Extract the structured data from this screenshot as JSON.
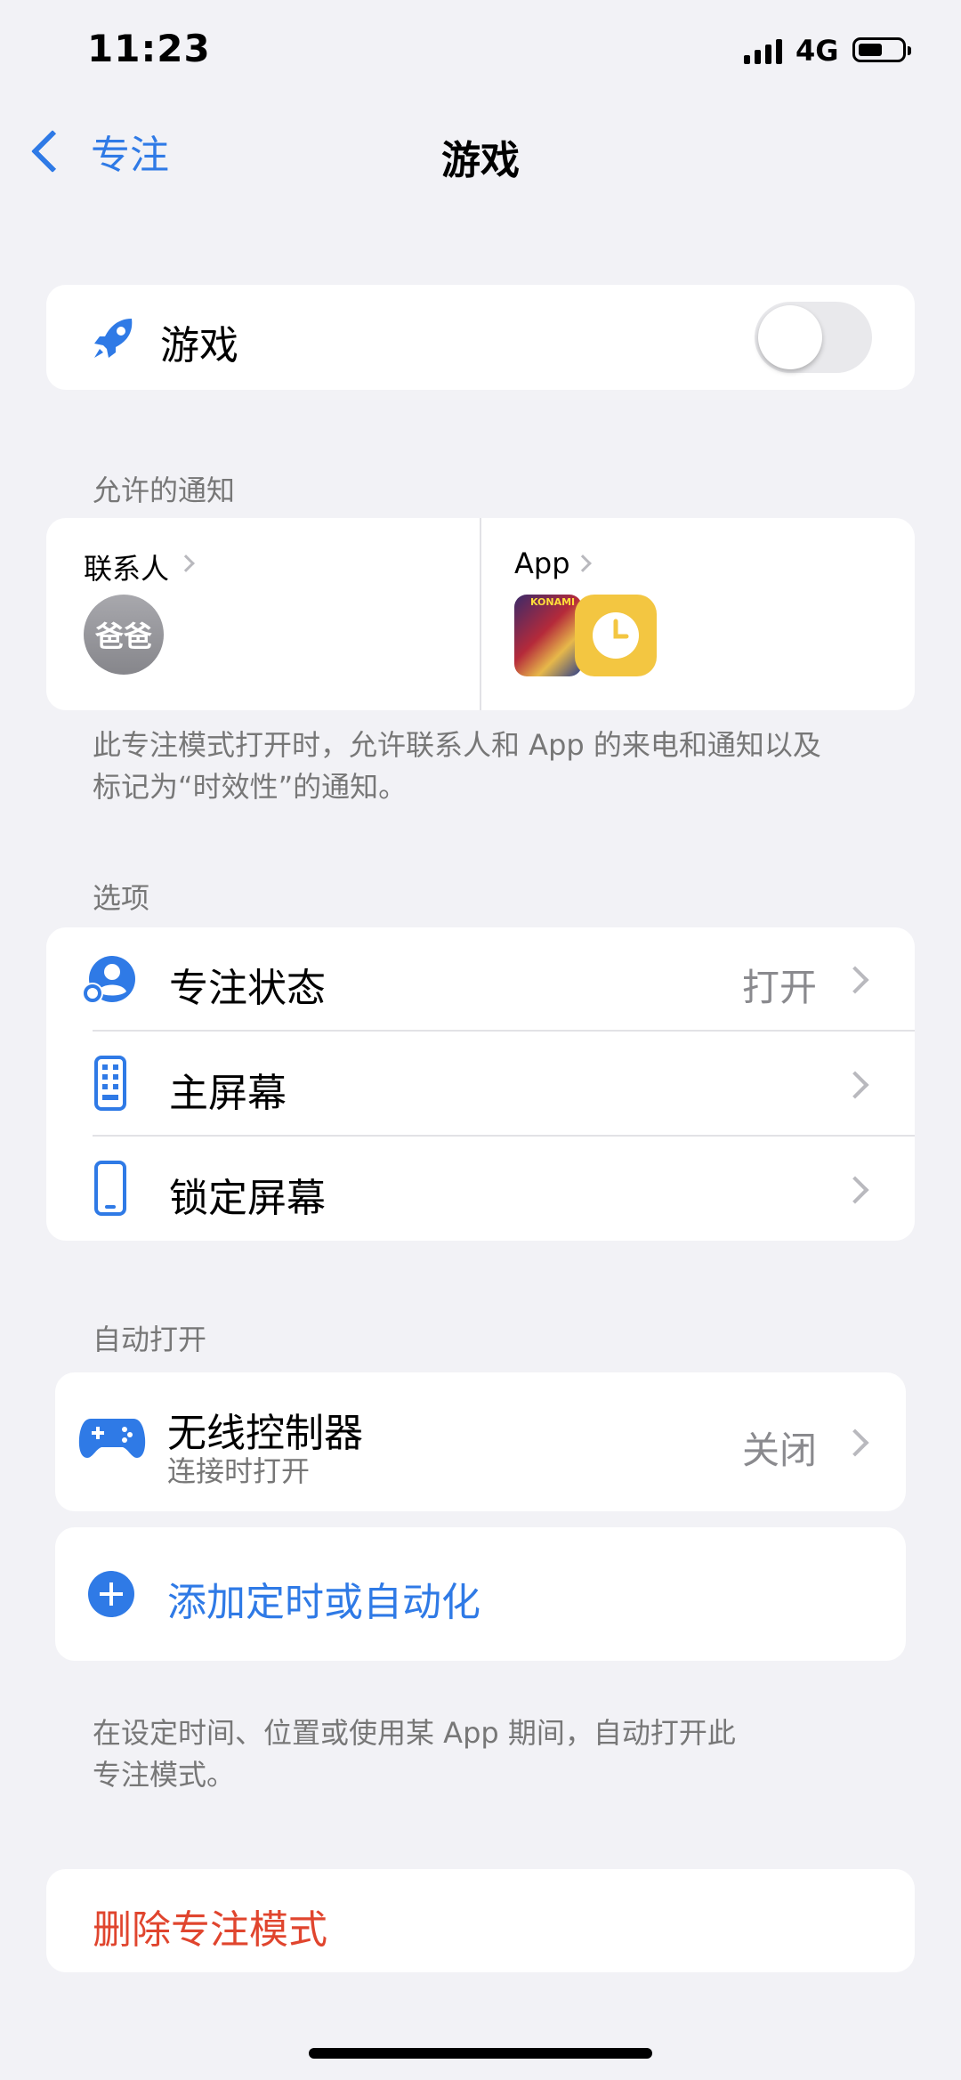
{
  "status_bar": {
    "time": "11:23",
    "network": "4G"
  },
  "nav": {
    "back_label": "专注",
    "title": "游戏"
  },
  "focus_toggle": {
    "label": "游戏",
    "enabled": false,
    "icon": "rocket-icon"
  },
  "allowed_notifications": {
    "section_label": "允许的通知",
    "people": {
      "label": "联系人",
      "contacts": [
        "爸爸"
      ]
    },
    "apps": {
      "label": "App",
      "icons": [
        "yugioh-app-icon",
        "clock-app-icon"
      ]
    },
    "footer": [
      "此专注模式打开时，允许联系人和 App 的来电和通知以及",
      "标记为“时效性”的通知。"
    ]
  },
  "options": {
    "section_label": "选项",
    "items": [
      {
        "label": "专注状态",
        "value": "打开",
        "icon": "focus-status-icon"
      },
      {
        "label": "主屏幕",
        "value": "",
        "icon": "home-screen-icon"
      },
      {
        "label": "锁定屏幕",
        "value": "",
        "icon": "lock-screen-icon"
      }
    ]
  },
  "auto_on": {
    "section_label": "自动打开",
    "controller": {
      "title": "无线控制器",
      "subtitle": "连接时打开",
      "value": "关闭",
      "icon": "game-controller-icon"
    },
    "add_label": "添加定时或自动化",
    "footer": [
      "在设定时间、位置或使用某 App 期间，自动打开此",
      "专注模式。"
    ]
  },
  "delete_label": "删除专注模式",
  "colors": {
    "accent": "#2f7ae6",
    "destructive": "#e0452e",
    "background": "#f2f2f6",
    "clock_yellow": "#f3c641"
  }
}
